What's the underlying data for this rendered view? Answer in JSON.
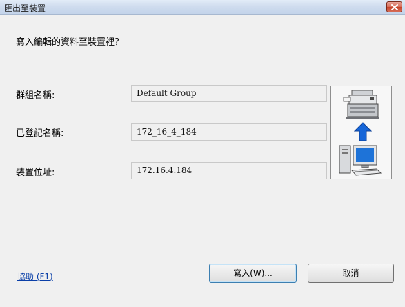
{
  "window": {
    "title": "匯出至裝置"
  },
  "dialog": {
    "question": "寫入編輯的資料至裝置裡？",
    "fields": [
      {
        "label": "群組名稱:",
        "value": "Default Group"
      },
      {
        "label": "已登記名稱:",
        "value": "172_16_4_184"
      },
      {
        "label": "裝置位址:",
        "value": "172.16.4.184"
      }
    ],
    "illustration_icons": [
      "printer-icon",
      "upload-arrow-icon",
      "computer-icon"
    ]
  },
  "footer": {
    "help_link": "協助 (F1)",
    "write_button": "寫入(W)...",
    "cancel_button": "取消"
  },
  "colors": {
    "accent_blue": "#1565d8",
    "link": "#0a3fa8",
    "close_red": "#c6432a"
  }
}
